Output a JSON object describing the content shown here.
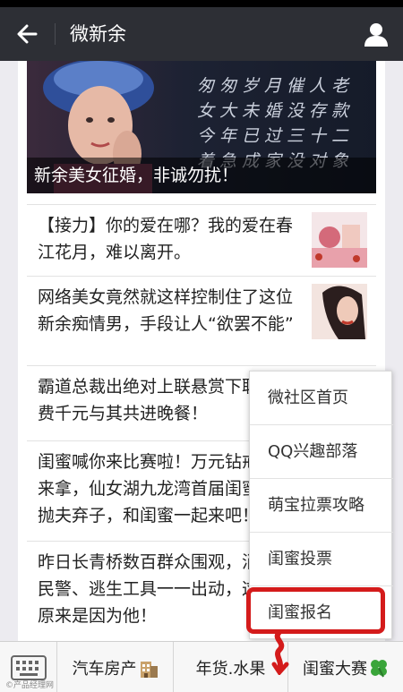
{
  "header": {
    "title": "微新余"
  },
  "hero": {
    "caption": "新余美女征婚，非诚勿扰！",
    "poem_lines": [
      "匆匆岁月催人老",
      "女大未婚没存款",
      "今年已过三十二",
      "着急成家没对象"
    ]
  },
  "articles": [
    {
      "title": "【接力】你的爱在哪？我的爱在春江花月，难以离开。"
    },
    {
      "title": "网络美女竟然就这样控制住了这位新余痴情男，手段让人“欲罢不能”"
    },
    {
      "title": "霸道总裁出绝对上联悬赏下联，免费千元与其共进晚餐！"
    },
    {
      "title": "闺蜜喊你来比赛啦！万元钻戒等你来拿，仙女湖九龙湾首届闺蜜节，抛夫弃子，和闺蜜一起来吧！"
    },
    {
      "title": "昨日长青桥数百群众围观，消防、民警、逃生工具一一出动，这阵仗原来是因为他！"
    }
  ],
  "popup_menu": {
    "items": [
      "微社区首页",
      "QQ兴趣部落",
      "萌宝拉票攻略",
      "闺蜜投票",
      "闺蜜报名"
    ]
  },
  "bottom_menu": {
    "tabs": [
      "汽车房产",
      "年货.水果",
      "闺蜜大赛"
    ]
  },
  "watermark": "©产品经理网",
  "colors": {
    "header_bg": "#2d2f35",
    "highlight": "#d41b1b"
  }
}
